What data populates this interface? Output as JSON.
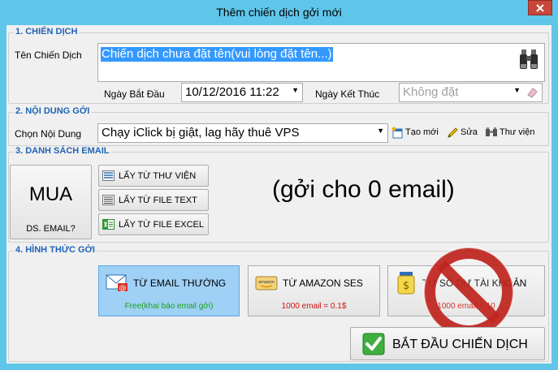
{
  "window": {
    "title": "Thêm chiến dịch gởi mới"
  },
  "section1": {
    "legend": "1. CHIẾN DỊCH",
    "name_label": "Tên Chiến Dịch",
    "name_value": "Chiến dịch chưa đặt tên(vui lòng đặt tên...)",
    "start_label": "Ngày Bắt Đầu",
    "start_value": "10/12/2016  11:22",
    "end_label": "Ngày Kết Thúc",
    "end_value": "Không đặt"
  },
  "section2": {
    "legend": "2. NỘI DUNG GỞI",
    "content_label": "Chọn Nội Dung",
    "content_value": "Chạy iClick bị giật, lag hãy thuê VPS",
    "new_label": "Tạo mới",
    "edit_label": "Sửa",
    "library_label": "Thư viện"
  },
  "section3": {
    "legend": "3. DANH SÁCH EMAIL",
    "buy_title": "MUA",
    "buy_sub": "DS. EMAIL?",
    "from_library": "LẤY TỪ THƯ VIỆN",
    "from_text": "LẤY TỪ FILE TEXT",
    "from_excel": "LẤY TỪ FILE EXCEL",
    "email_count": "(gởi cho 0 email)"
  },
  "section4": {
    "legend": "4. HÌNH THỨC GỞI",
    "options": [
      {
        "title": "TỪ EMAIL THƯỜNG",
        "sub": "Free(khai báo email gởi)",
        "active": true,
        "sub_color": "#1aa31a"
      },
      {
        "title": "TỪ AMAZON SES",
        "sub": "1000 email = 0.1$",
        "active": false,
        "sub_color": "#d01010"
      },
      {
        "title": "TỪ SỐ DƯ TÀI KHOẢN",
        "sub": "1000 email = 10",
        "active": false,
        "sub_color": "#d01010"
      }
    ],
    "start_label": "BẮT ĐẦU CHIẾN DỊCH"
  },
  "colors": {
    "accent": "#5fc6ea",
    "legend": "#1f63b5",
    "selection": "#3399ff",
    "active_option": "#9fd0f6",
    "close": "#c7473a"
  },
  "icons": [
    "close-icon",
    "binoculars-icon",
    "dropdown-arrow-icon",
    "eraser-icon",
    "new-document-icon",
    "pencil-icon",
    "library-icon",
    "list-icon",
    "text-file-icon",
    "excel-icon",
    "email-icon",
    "amazon-icon",
    "coin-jar-icon",
    "no-entry-icon",
    "checkmark-icon"
  ]
}
